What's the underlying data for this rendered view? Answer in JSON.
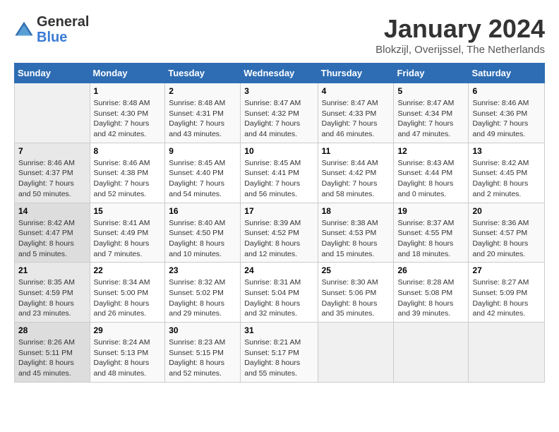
{
  "logo": {
    "general": "General",
    "blue": "Blue"
  },
  "title": "January 2024",
  "location": "Blokzijl, Overijssel, The Netherlands",
  "weekdays": [
    "Sunday",
    "Monday",
    "Tuesday",
    "Wednesday",
    "Thursday",
    "Friday",
    "Saturday"
  ],
  "weeks": [
    [
      {
        "num": "",
        "info": ""
      },
      {
        "num": "1",
        "info": "Sunrise: 8:48 AM\nSunset: 4:30 PM\nDaylight: 7 hours\nand 42 minutes."
      },
      {
        "num": "2",
        "info": "Sunrise: 8:48 AM\nSunset: 4:31 PM\nDaylight: 7 hours\nand 43 minutes."
      },
      {
        "num": "3",
        "info": "Sunrise: 8:47 AM\nSunset: 4:32 PM\nDaylight: 7 hours\nand 44 minutes."
      },
      {
        "num": "4",
        "info": "Sunrise: 8:47 AM\nSunset: 4:33 PM\nDaylight: 7 hours\nand 46 minutes."
      },
      {
        "num": "5",
        "info": "Sunrise: 8:47 AM\nSunset: 4:34 PM\nDaylight: 7 hours\nand 47 minutes."
      },
      {
        "num": "6",
        "info": "Sunrise: 8:46 AM\nSunset: 4:36 PM\nDaylight: 7 hours\nand 49 minutes."
      }
    ],
    [
      {
        "num": "7",
        "info": "Sunrise: 8:46 AM\nSunset: 4:37 PM\nDaylight: 7 hours\nand 50 minutes."
      },
      {
        "num": "8",
        "info": "Sunrise: 8:46 AM\nSunset: 4:38 PM\nDaylight: 7 hours\nand 52 minutes."
      },
      {
        "num": "9",
        "info": "Sunrise: 8:45 AM\nSunset: 4:40 PM\nDaylight: 7 hours\nand 54 minutes."
      },
      {
        "num": "10",
        "info": "Sunrise: 8:45 AM\nSunset: 4:41 PM\nDaylight: 7 hours\nand 56 minutes."
      },
      {
        "num": "11",
        "info": "Sunrise: 8:44 AM\nSunset: 4:42 PM\nDaylight: 7 hours\nand 58 minutes."
      },
      {
        "num": "12",
        "info": "Sunrise: 8:43 AM\nSunset: 4:44 PM\nDaylight: 8 hours\nand 0 minutes."
      },
      {
        "num": "13",
        "info": "Sunrise: 8:42 AM\nSunset: 4:45 PM\nDaylight: 8 hours\nand 2 minutes."
      }
    ],
    [
      {
        "num": "14",
        "info": "Sunrise: 8:42 AM\nSunset: 4:47 PM\nDaylight: 8 hours\nand 5 minutes."
      },
      {
        "num": "15",
        "info": "Sunrise: 8:41 AM\nSunset: 4:49 PM\nDaylight: 8 hours\nand 7 minutes."
      },
      {
        "num": "16",
        "info": "Sunrise: 8:40 AM\nSunset: 4:50 PM\nDaylight: 8 hours\nand 10 minutes."
      },
      {
        "num": "17",
        "info": "Sunrise: 8:39 AM\nSunset: 4:52 PM\nDaylight: 8 hours\nand 12 minutes."
      },
      {
        "num": "18",
        "info": "Sunrise: 8:38 AM\nSunset: 4:53 PM\nDaylight: 8 hours\nand 15 minutes."
      },
      {
        "num": "19",
        "info": "Sunrise: 8:37 AM\nSunset: 4:55 PM\nDaylight: 8 hours\nand 18 minutes."
      },
      {
        "num": "20",
        "info": "Sunrise: 8:36 AM\nSunset: 4:57 PM\nDaylight: 8 hours\nand 20 minutes."
      }
    ],
    [
      {
        "num": "21",
        "info": "Sunrise: 8:35 AM\nSunset: 4:59 PM\nDaylight: 8 hours\nand 23 minutes."
      },
      {
        "num": "22",
        "info": "Sunrise: 8:34 AM\nSunset: 5:00 PM\nDaylight: 8 hours\nand 26 minutes."
      },
      {
        "num": "23",
        "info": "Sunrise: 8:32 AM\nSunset: 5:02 PM\nDaylight: 8 hours\nand 29 minutes."
      },
      {
        "num": "24",
        "info": "Sunrise: 8:31 AM\nSunset: 5:04 PM\nDaylight: 8 hours\nand 32 minutes."
      },
      {
        "num": "25",
        "info": "Sunrise: 8:30 AM\nSunset: 5:06 PM\nDaylight: 8 hours\nand 35 minutes."
      },
      {
        "num": "26",
        "info": "Sunrise: 8:28 AM\nSunset: 5:08 PM\nDaylight: 8 hours\nand 39 minutes."
      },
      {
        "num": "27",
        "info": "Sunrise: 8:27 AM\nSunset: 5:09 PM\nDaylight: 8 hours\nand 42 minutes."
      }
    ],
    [
      {
        "num": "28",
        "info": "Sunrise: 8:26 AM\nSunset: 5:11 PM\nDaylight: 8 hours\nand 45 minutes."
      },
      {
        "num": "29",
        "info": "Sunrise: 8:24 AM\nSunset: 5:13 PM\nDaylight: 8 hours\nand 48 minutes."
      },
      {
        "num": "30",
        "info": "Sunrise: 8:23 AM\nSunset: 5:15 PM\nDaylight: 8 hours\nand 52 minutes."
      },
      {
        "num": "31",
        "info": "Sunrise: 8:21 AM\nSunset: 5:17 PM\nDaylight: 8 hours\nand 55 minutes."
      },
      {
        "num": "",
        "info": ""
      },
      {
        "num": "",
        "info": ""
      },
      {
        "num": "",
        "info": ""
      }
    ]
  ]
}
